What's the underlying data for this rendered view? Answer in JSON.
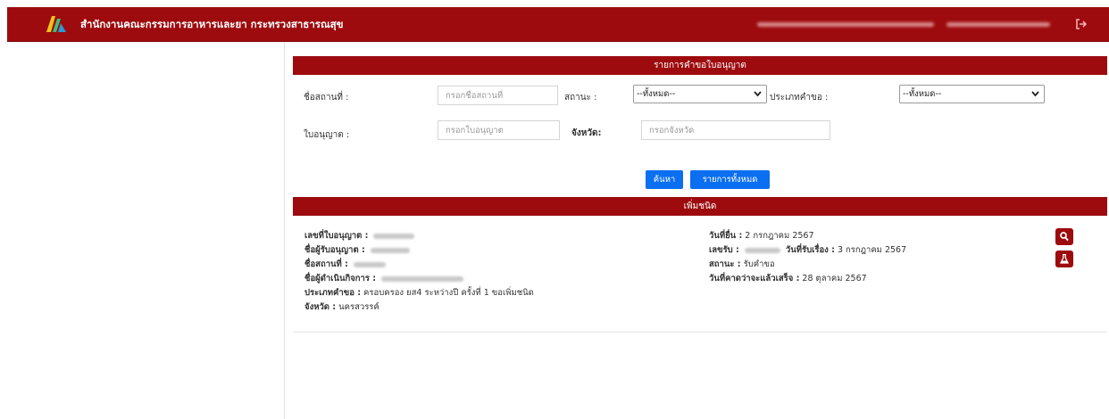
{
  "header": {
    "brand": "สำนักงานคณะกรรมการอาหารและยา กระทรวงสาธารณสุข",
    "logo_icon": "fda-logo",
    "logout_icon": "sign-out-icon",
    "brand_color": "#9d0b0e"
  },
  "search_panel": {
    "title": "รายการคำขอใบอนุญาต",
    "place_name": {
      "label": "ชื่อสถานที่ :",
      "placeholder": "กรอกชื่อสถานที่",
      "value": ""
    },
    "status": {
      "label": "สถานะ :",
      "selected": "--ทั้งหมด--"
    },
    "request_type": {
      "label": "ประเภทคำขอ :",
      "selected": "--ทั้งหมด--"
    },
    "license": {
      "label": "ใบอนุญาต :",
      "placeholder": "กรอกใบอนุญาต",
      "value": ""
    },
    "province": {
      "label": "จังหวัด:",
      "placeholder": "กรอกจังหวัด",
      "value": ""
    },
    "search_button": "ค้นหา",
    "all_button": "รายการทั้งหมด",
    "button_color": "#0a6ff0"
  },
  "result_panel": {
    "title": "เพิ่มชนิด",
    "license_no_label": "เลขที่ใบอนุญาต :",
    "licensee_label": "ชื่อผู้รับอนุญาต :",
    "place_label": "ชื่อสถานที่ :",
    "operator_label": "ชื่อผู้ดำเนินกิจการ :",
    "request_type_label": "ประเภทคำขอ :",
    "request_type_value": "ครอบครอง ยส4 ระหว่างปี ครั้งที่ 1 ขอเพิ่มชนิด",
    "province_label": "จังหวัด :",
    "province_value": "นครสวรรค์",
    "submit_date_label": "วันที่ยื่น :",
    "submit_date_value": "2 กรกฎาคม 2567",
    "receipt_no_label": "เลขรับ :",
    "receipt_date_label": "วันที่รับเรื่อง :",
    "receipt_date_value": "3 กรกฎาคม 2567",
    "status_label": "สถานะ :",
    "status_value": "รับคำขอ",
    "expected_date_label": "วันที่คาดว่าจะแล้วเสร็จ :",
    "expected_date_value": "28 ตุลาคม 2567",
    "view_icon": "search-icon",
    "lab_icon": "flask-icon"
  }
}
